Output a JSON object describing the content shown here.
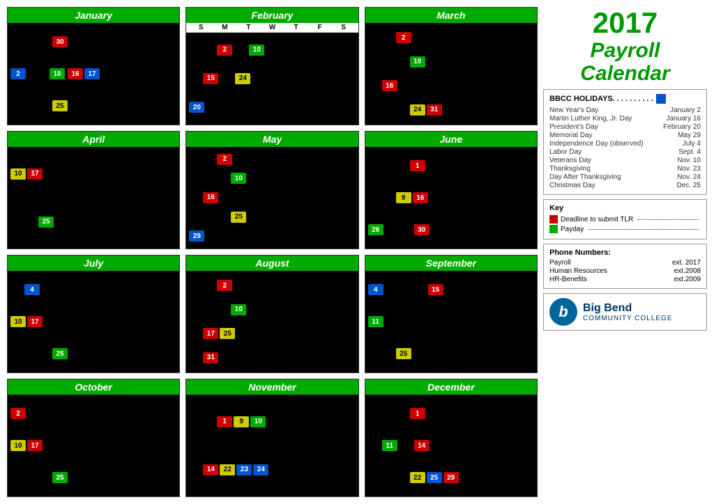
{
  "title": {
    "year": "2017",
    "line1": "Payroll",
    "line2": "Calendar"
  },
  "colors": {
    "accent": "#009900",
    "red": "#cc0000",
    "green": "#00aa00",
    "blue": "#0055cc",
    "yellow": "#cccc00"
  },
  "months": [
    {
      "name": "January",
      "rows": [
        {
          "indent": 3,
          "badges": [
            {
              "num": "30",
              "color": "red"
            }
          ]
        },
        {
          "indent": 0,
          "badges": [
            {
              "num": "2",
              "color": "blue"
            },
            {
              "num": "10",
              "color": "green",
              "ml": 30
            },
            {
              "num": "16",
              "color": "red",
              "ml": 0
            },
            {
              "num": "17",
              "color": "blue"
            }
          ]
        },
        {
          "indent": 3,
          "badges": [
            {
              "num": "25",
              "color": "yellow"
            }
          ]
        }
      ]
    },
    {
      "name": "February",
      "showDow": true,
      "rows": [
        {
          "indent": 2,
          "badges": [
            {
              "num": "2",
              "color": "red"
            },
            {
              "num": "10",
              "color": "green",
              "ml": 20
            }
          ]
        },
        {
          "indent": 1,
          "badges": [
            {
              "num": "15",
              "color": "red"
            },
            {
              "num": "24",
              "color": "yellow",
              "ml": 20
            }
          ]
        },
        {
          "indent": 0,
          "badges": [
            {
              "num": "20",
              "color": "blue"
            }
          ]
        }
      ]
    },
    {
      "name": "March",
      "rows": [
        {
          "indent": 2,
          "badges": [
            {
              "num": "2",
              "color": "red"
            }
          ]
        },
        {
          "indent": 3,
          "badges": [
            {
              "num": "10",
              "color": "green"
            }
          ]
        },
        {
          "indent": 1,
          "badges": [
            {
              "num": "16",
              "color": "red"
            }
          ]
        },
        {
          "indent": 3,
          "badges": [
            {
              "num": "24",
              "color": "yellow"
            },
            {
              "num": "31",
              "color": "red"
            }
          ]
        }
      ]
    },
    {
      "name": "April",
      "rows": [
        {
          "indent": 0,
          "badges": [
            {
              "num": "10",
              "color": "yellow"
            },
            {
              "num": "17",
              "color": "red"
            }
          ]
        },
        {
          "indent": 2,
          "badges": [
            {
              "num": "25",
              "color": "green"
            }
          ]
        }
      ]
    },
    {
      "name": "May",
      "rows": [
        {
          "indent": 2,
          "badges": [
            {
              "num": "2",
              "color": "red"
            }
          ]
        },
        {
          "indent": 3,
          "badges": [
            {
              "num": "10",
              "color": "green"
            }
          ]
        },
        {
          "indent": 1,
          "badges": [
            {
              "num": "16",
              "color": "red"
            }
          ]
        },
        {
          "indent": 3,
          "badges": [
            {
              "num": "25",
              "color": "yellow"
            }
          ]
        },
        {
          "indent": 0,
          "badges": [
            {
              "num": "29",
              "color": "blue"
            }
          ]
        }
      ]
    },
    {
      "name": "June",
      "rows": [
        {
          "indent": 3,
          "badges": [
            {
              "num": "1",
              "color": "red"
            }
          ]
        },
        {
          "indent": 2,
          "badges": [
            {
              "num": "9",
              "color": "yellow"
            },
            {
              "num": "16",
              "color": "red"
            }
          ]
        },
        {
          "indent": 0,
          "badges": [
            {
              "num": "26",
              "color": "green"
            },
            {
              "num": "30",
              "color": "red",
              "ml": 40
            }
          ]
        }
      ]
    },
    {
      "name": "July",
      "rows": [
        {
          "indent": 1,
          "badges": [
            {
              "num": "4",
              "color": "blue"
            }
          ]
        },
        {
          "indent": 0,
          "badges": [
            {
              "num": "10",
              "color": "yellow"
            },
            {
              "num": "17",
              "color": "red"
            }
          ]
        },
        {
          "indent": 3,
          "badges": [
            {
              "num": "25",
              "color": "green"
            }
          ]
        }
      ]
    },
    {
      "name": "August",
      "rows": [
        {
          "indent": 2,
          "badges": [
            {
              "num": "2",
              "color": "red"
            }
          ]
        },
        {
          "indent": 3,
          "badges": [
            {
              "num": "10",
              "color": "green"
            }
          ]
        },
        {
          "indent": 1,
          "badges": [
            {
              "num": "17",
              "color": "red"
            },
            {
              "num": "25",
              "color": "yellow"
            }
          ]
        },
        {
          "indent": 1,
          "badges": [
            {
              "num": "31",
              "color": "red"
            }
          ]
        }
      ]
    },
    {
      "name": "September",
      "rows": [
        {
          "indent": 0,
          "badges": [
            {
              "num": "4",
              "color": "blue"
            },
            {
              "num": "15",
              "color": "red",
              "ml": 60
            }
          ]
        },
        {
          "indent": 0,
          "badges": [
            {
              "num": "11",
              "color": "green"
            }
          ]
        },
        {
          "indent": 2,
          "badges": [
            {
              "num": "25",
              "color": "yellow"
            }
          ]
        }
      ]
    },
    {
      "name": "October",
      "rows": [
        {
          "indent": 0,
          "badges": [
            {
              "num": "2",
              "color": "red"
            }
          ]
        },
        {
          "indent": 0,
          "badges": [
            {
              "num": "10",
              "color": "yellow"
            },
            {
              "num": "17",
              "color": "red"
            }
          ]
        },
        {
          "indent": 3,
          "badges": [
            {
              "num": "25",
              "color": "green"
            }
          ]
        }
      ]
    },
    {
      "name": "November",
      "rows": [
        {
          "indent": 2,
          "badges": [
            {
              "num": "1",
              "color": "red"
            },
            {
              "num": "9",
              "color": "yellow"
            },
            {
              "num": "10",
              "color": "green"
            }
          ]
        },
        {
          "indent": 1,
          "badges": [
            {
              "num": "14",
              "color": "red"
            },
            {
              "num": "22",
              "color": "yellow"
            },
            {
              "num": "23",
              "color": "blue"
            },
            {
              "num": "24",
              "color": "blue"
            }
          ]
        }
      ]
    },
    {
      "name": "December",
      "rows": [
        {
          "indent": 3,
          "badges": [
            {
              "num": "1",
              "color": "red"
            }
          ]
        },
        {
          "indent": 1,
          "badges": [
            {
              "num": "11",
              "color": "green"
            },
            {
              "num": "14",
              "color": "red",
              "ml": 20
            }
          ]
        },
        {
          "indent": 3,
          "badges": [
            {
              "num": "22",
              "color": "yellow"
            },
            {
              "num": "25",
              "color": "blue"
            },
            {
              "num": "29",
              "color": "red"
            }
          ]
        }
      ]
    }
  ],
  "holidays": {
    "title": "BBCC HOLIDAYS.",
    "items": [
      {
        "name": "New Year's Day",
        "date": "January 2"
      },
      {
        "name": "Martin Luther King, Jr. Day",
        "date": "January 16"
      },
      {
        "name": "President's Day",
        "date": "February 20"
      },
      {
        "name": "Memorial Day",
        "date": "May 29"
      },
      {
        "name": "Independence Day (observed)",
        "date": "July 4"
      },
      {
        "name": "Labor Day",
        "date": "Sept. 4"
      },
      {
        "name": "Veterans Day",
        "date": "Nov. 10"
      },
      {
        "name": "Thanksgiving",
        "date": "Nov. 23"
      },
      {
        "name": "Day After Thanksgiving",
        "date": "Nov. 24"
      },
      {
        "name": "Christmas Day",
        "date": "Dec. 25"
      }
    ]
  },
  "key": {
    "title": "Key",
    "items": [
      {
        "label": "Deadline to submit TLR",
        "color": "red"
      },
      {
        "label": "Payday",
        "color": "green"
      }
    ]
  },
  "phone": {
    "title": "Phone Numbers:",
    "items": [
      {
        "name": "Payroll",
        "number": "ext. 2017"
      },
      {
        "name": "Human Resources",
        "number": "ext.2008"
      },
      {
        "name": "HR-Benefits",
        "number": "ext.2009"
      }
    ]
  },
  "logo": {
    "icon": "b",
    "name": "Big Bend",
    "subtitle": "COMMUNITY COLLEGE"
  },
  "dow": [
    "S",
    "M",
    "T",
    "W",
    "T",
    "F",
    "S"
  ]
}
